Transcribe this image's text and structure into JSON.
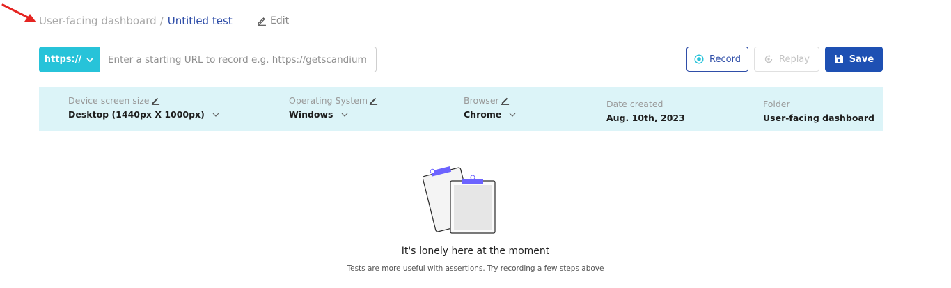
{
  "breadcrumb": {
    "parent": "User-facing dashboard",
    "separator": "/",
    "current": "Untitled test",
    "edit_label": "Edit"
  },
  "url_bar": {
    "protocol": "https://",
    "placeholder": "Enter a starting URL to record e.g. https://getscandium.c..."
  },
  "actions": {
    "record_label": "Record",
    "replay_label": "Replay",
    "save_label": "Save"
  },
  "info": {
    "device": {
      "label": "Device screen size",
      "value": "Desktop (1440px X 1000px)"
    },
    "os": {
      "label": "Operating System",
      "value": "Windows"
    },
    "browser": {
      "label": "Browser",
      "value": "Chrome"
    },
    "date": {
      "label": "Date created",
      "value": "Aug. 10th, 2023"
    },
    "folder": {
      "label": "Folder",
      "value": "User-facing dashboard"
    }
  },
  "empty_state": {
    "title": "It's lonely here at the moment",
    "subtitle": "Tests are more useful with assertions. Try recording a few steps above"
  },
  "colors": {
    "accent_teal": "#27c3d9",
    "primary_blue": "#1e50b3",
    "link_blue": "#2f4ea8",
    "strip_bg": "#dcf4f8",
    "annotation_red": "#e52421"
  },
  "icons": [
    "annotation-arrow",
    "pencil-icon",
    "chevron-down-icon",
    "record-icon",
    "replay-icon",
    "floppy-disk-icon",
    "clipboard-illustration"
  ]
}
